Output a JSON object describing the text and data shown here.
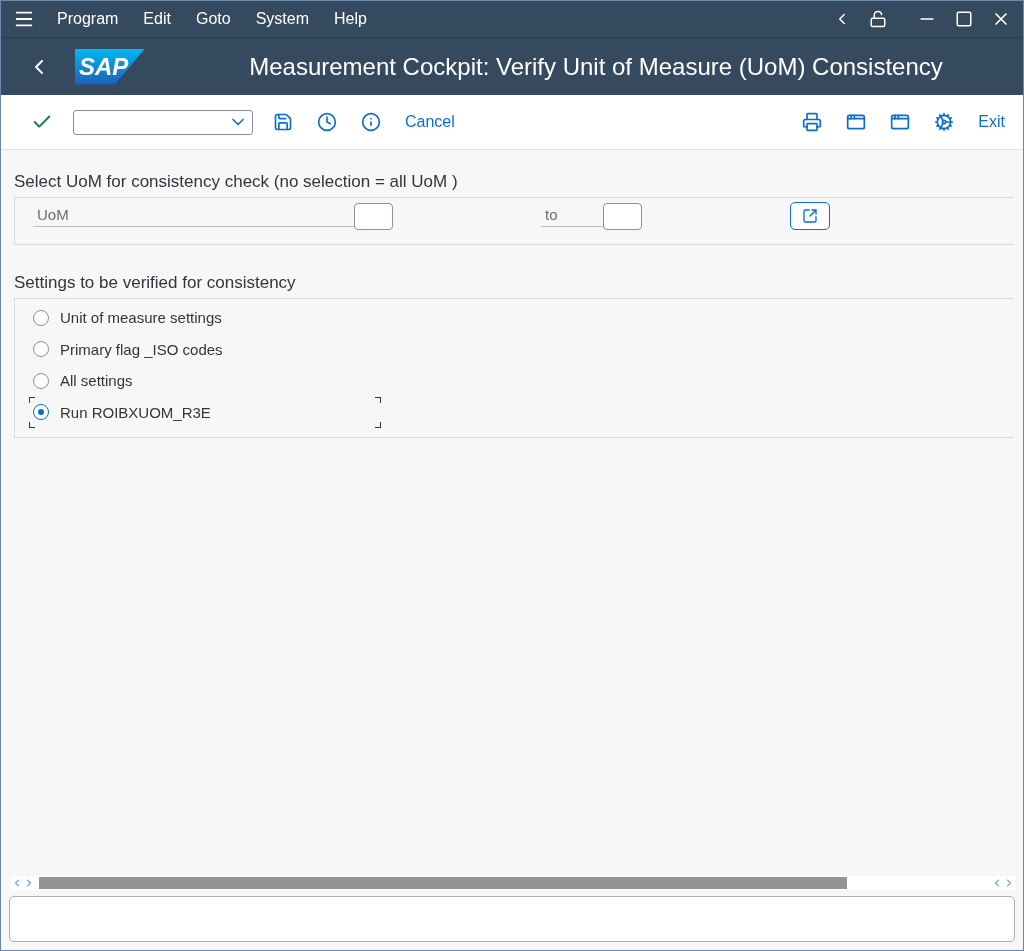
{
  "menu_bar": {
    "items": [
      "Program",
      "Edit",
      "Goto",
      "System",
      "Help"
    ]
  },
  "title_bar": {
    "logo_text": "SAP",
    "title": "Measurement Cockpit: Verify Unit of Measure (UoM) Consistency"
  },
  "toolbar": {
    "cancel": "Cancel",
    "exit": "Exit"
  },
  "selection": {
    "title": "Select UoM for consistency check (no selection = all UoM )",
    "field_label": "UoM",
    "to_label": "to"
  },
  "settings": {
    "title": "Settings to be verified for consistency",
    "options": [
      {
        "label": "Unit of measure settings",
        "selected": false
      },
      {
        "label": "Primary flag _ISO codes",
        "selected": false
      },
      {
        "label": "All settings",
        "selected": false
      },
      {
        "label": "Run ROIBXUOM_R3E",
        "selected": true
      }
    ]
  }
}
